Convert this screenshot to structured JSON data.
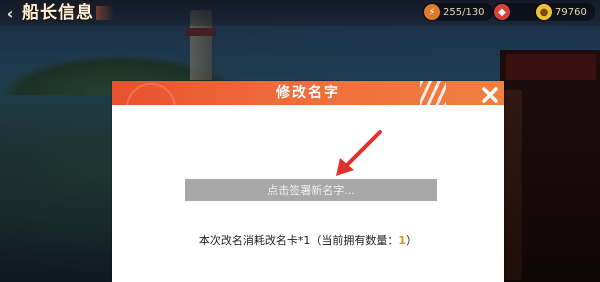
{
  "window": {
    "title": "船长信息"
  },
  "resources": [
    {
      "icon": "stamina-icon",
      "value": "255/130"
    },
    {
      "icon": "ruby-icon",
      "value": ""
    },
    {
      "icon": "coin-icon",
      "value": "79760"
    }
  ],
  "dialog": {
    "title": "修改名字",
    "input": {
      "placeholder": "点击签署新名字...",
      "value": ""
    },
    "consume": {
      "prefix": "本次改名消耗改名卡",
      "cost": "*1",
      "owned_label": "（当前拥有数量：",
      "owned_count": "1",
      "suffix": "）"
    }
  },
  "colors": {
    "header_start": "#e8502f",
    "header_end": "#f0803f",
    "arrow": "#e0322d",
    "input_bg": "#a8a8a8",
    "highlight": "#d89a1a"
  }
}
